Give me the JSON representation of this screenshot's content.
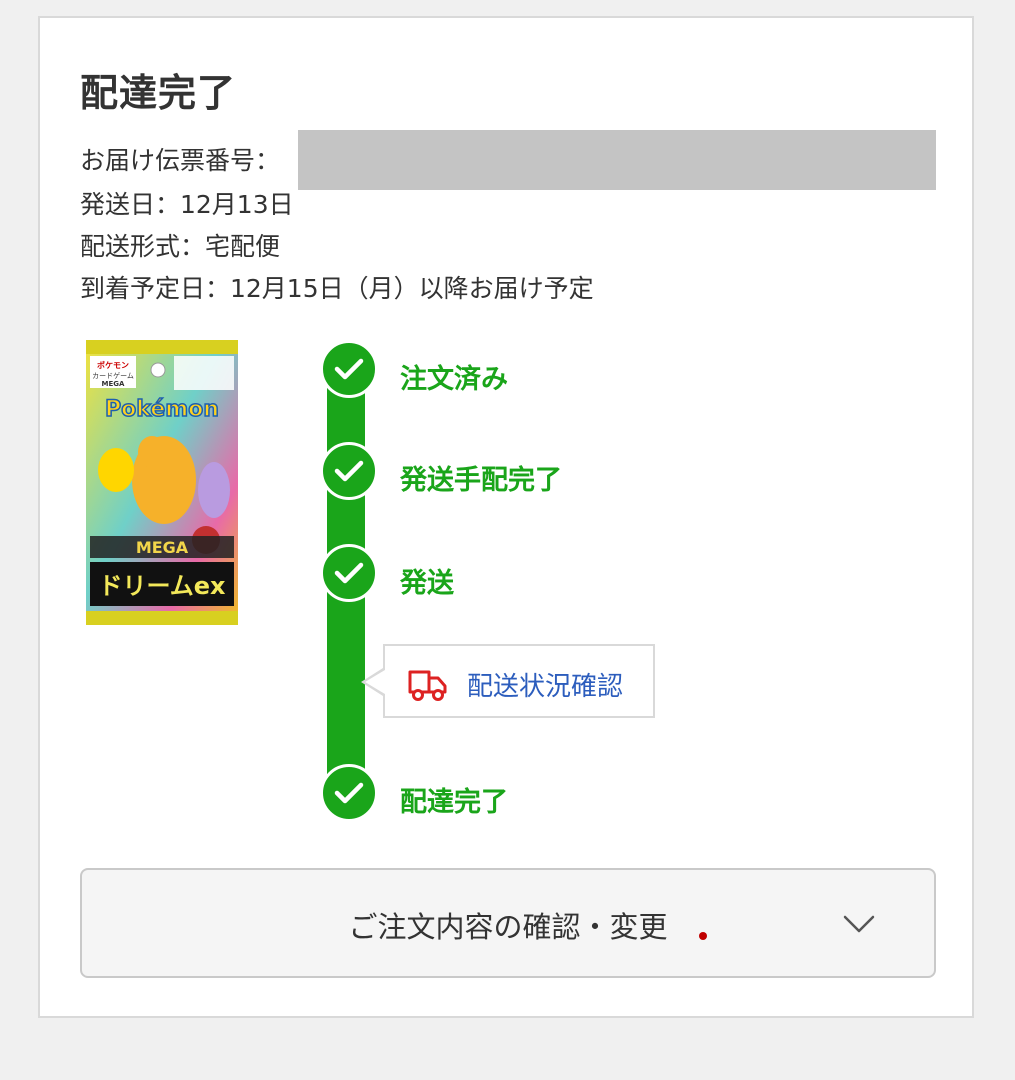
{
  "header": {
    "title": "配達完了"
  },
  "shipment": {
    "slip_label": "お届け伝票番号：",
    "ship_date": "発送日：12月13日",
    "method": "配送形式：宅配便",
    "arrival": "到着予定日：12月15日（月）以降お届け予定"
  },
  "product": {
    "image_text_top": "ポケモンカードゲーム MEGA",
    "image_text_logo": "Pokémon",
    "image_text_name": "ドリームex",
    "image_text_sub": "MEGA"
  },
  "timeline": {
    "steps": [
      {
        "label": "注文済み"
      },
      {
        "label": "発送手配完了"
      },
      {
        "label": "発送"
      },
      {
        "label": "配達完了"
      }
    ],
    "track_button": {
      "label": "配送状況確認",
      "icon": "truck-icon"
    }
  },
  "order_details": {
    "label": "ご注文内容の確認・変更",
    "icon": "chevron-down-icon"
  },
  "colors": {
    "accent_green": "#1aa51a",
    "link_blue": "#2c5dbd",
    "alert_red": "#c00000"
  }
}
